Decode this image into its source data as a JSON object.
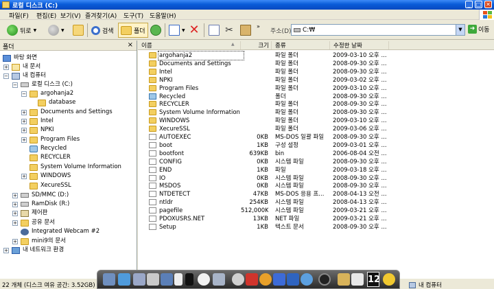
{
  "window": {
    "title": "로컬 디스크 (C:)"
  },
  "menu": [
    "파일(F)",
    "편집(E)",
    "보기(V)",
    "즐겨찾기(A)",
    "도구(T)",
    "도움말(H)"
  ],
  "toolbar": {
    "back_label": "뒤로",
    "search_label": "검색",
    "folders_label": "폴더"
  },
  "address": {
    "label": "주소(D)",
    "value": "C:₩",
    "go_label": "이동"
  },
  "folder_pane": {
    "title": "폴더",
    "items": [
      {
        "label": "바탕 화면",
        "icon": "desktop-icon"
      },
      {
        "label": "내 문서",
        "icon": "documents-icon"
      },
      {
        "label": "내 컴퓨터",
        "icon": "computer-icon"
      },
      {
        "label": "로컬 디스크 (C:)",
        "icon": "drive-icon"
      },
      {
        "label": "argohanja2",
        "icon": "folder-icon"
      },
      {
        "label": "database",
        "icon": "folder-icon"
      },
      {
        "label": "Documents and Settings",
        "icon": "folder-icon"
      },
      {
        "label": "Intel",
        "icon": "folder-icon"
      },
      {
        "label": "NPKI",
        "icon": "folder-icon"
      },
      {
        "label": "Program Files",
        "icon": "folder-icon"
      },
      {
        "label": "Recycled",
        "icon": "recycle-icon"
      },
      {
        "label": "RECYCLER",
        "icon": "folder-icon"
      },
      {
        "label": "System Volume Information",
        "icon": "folder-icon"
      },
      {
        "label": "WINDOWS",
        "icon": "folder-icon"
      },
      {
        "label": "XecureSSL",
        "icon": "folder-icon"
      },
      {
        "label": "SD/MMC (D:)",
        "icon": "drive-icon"
      },
      {
        "label": "RamDisk (R:)",
        "icon": "drive-icon"
      },
      {
        "label": "제어판",
        "icon": "control-panel-icon"
      },
      {
        "label": "공유 문서",
        "icon": "folder-icon"
      },
      {
        "label": "Integrated Webcam #2",
        "icon": "camera-icon"
      },
      {
        "label": "mini9의 문서",
        "icon": "folder-icon"
      },
      {
        "label": "내 네트워크 환경",
        "icon": "network-icon"
      }
    ]
  },
  "list": {
    "columns": {
      "name": "이름",
      "size": "크기",
      "type": "종류",
      "date": "수정한 날짜"
    },
    "rows": [
      {
        "name": "argohanja2",
        "size": "",
        "type": "파일 폴더",
        "date": "2009-03-10 오후 ...",
        "icon": "folder"
      },
      {
        "name": "Documents and Settings",
        "size": "",
        "type": "파일 폴더",
        "date": "2008-09-30 오후 ...",
        "icon": "folder"
      },
      {
        "name": "Intel",
        "size": "",
        "type": "파일 폴더",
        "date": "2008-09-30 오후 ...",
        "icon": "folder"
      },
      {
        "name": "NPKI",
        "size": "",
        "type": "파일 폴더",
        "date": "2009-03-02 오후 ...",
        "icon": "folder"
      },
      {
        "name": "Program Files",
        "size": "",
        "type": "파일 폴더",
        "date": "2009-03-10 오후 ...",
        "icon": "folder"
      },
      {
        "name": "Recycled",
        "size": "",
        "type": "폴더",
        "date": "2008-09-30 오후 ...",
        "icon": "recycle"
      },
      {
        "name": "RECYCLER",
        "size": "",
        "type": "파일 폴더",
        "date": "2008-09-30 오후 ...",
        "icon": "folder"
      },
      {
        "name": "System Volume Information",
        "size": "",
        "type": "파일 폴더",
        "date": "2008-09-30 오후 ...",
        "icon": "folder"
      },
      {
        "name": "WINDOWS",
        "size": "",
        "type": "파일 폴더",
        "date": "2009-03-10 오후 ...",
        "icon": "folder"
      },
      {
        "name": "XecureSSL",
        "size": "",
        "type": "파일 폴더",
        "date": "2009-03-06 오후 ...",
        "icon": "folder"
      },
      {
        "name": "AUTOEXEC",
        "size": "0KB",
        "type": "MS-DOS 일괄 파일",
        "date": "2008-09-30 오후 ...",
        "icon": "file"
      },
      {
        "name": "boot",
        "size": "1KB",
        "type": "구성 설정",
        "date": "2009-03-01 오후 ...",
        "icon": "file"
      },
      {
        "name": "bootfont",
        "size": "639KB",
        "type": "bin",
        "date": "2006-08-04 오전 ...",
        "icon": "file"
      },
      {
        "name": "CONFIG",
        "size": "0KB",
        "type": "시스템 파일",
        "date": "2008-09-30 오후 ...",
        "icon": "file"
      },
      {
        "name": "END",
        "size": "1KB",
        "type": "파일",
        "date": "2009-03-18 오후 ...",
        "icon": "file"
      },
      {
        "name": "IO",
        "size": "0KB",
        "type": "시스템 파일",
        "date": "2008-09-30 오후 ...",
        "icon": "file"
      },
      {
        "name": "MSDOS",
        "size": "0KB",
        "type": "시스템 파일",
        "date": "2008-09-30 오후 ...",
        "icon": "file"
      },
      {
        "name": "NTDETECT",
        "size": "47KB",
        "type": "MS-DOS 응용 프...",
        "date": "2008-04-13 오전 ...",
        "icon": "file"
      },
      {
        "name": "ntldr",
        "size": "254KB",
        "type": "시스템 파일",
        "date": "2008-04-13 오후 ...",
        "icon": "file"
      },
      {
        "name": "pagefile",
        "size": "512,000KB",
        "type": "시스템 파일",
        "date": "2009-03-21 오후 ...",
        "icon": "file"
      },
      {
        "name": "PDOXUSRS.NET",
        "size": "13KB",
        "type": "NET 파일",
        "date": "2009-03-21 오후 ...",
        "icon": "file"
      },
      {
        "name": "Setup",
        "size": "1KB",
        "type": "텍스트 문서",
        "date": "2008-09-30 오후 ...",
        "icon": "file"
      }
    ]
  },
  "status": {
    "left": "22 개체 (디스크 여유 공간: 3.52GB)",
    "right": "내 컴퓨터"
  },
  "dock": {
    "clock_text": "12"
  }
}
